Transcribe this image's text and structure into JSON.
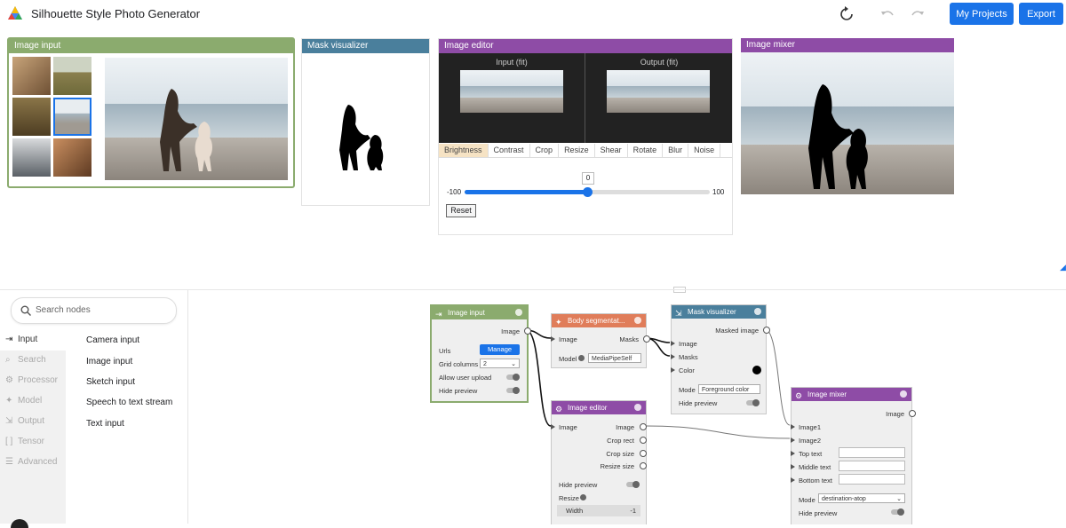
{
  "header": {
    "title": "Silhouette Style Photo Generator",
    "my_projects_label": "My Projects",
    "export_label": "Export"
  },
  "panels": {
    "image_input": {
      "title": "Image input"
    },
    "mask_visualizer": {
      "title": "Mask visualizer"
    },
    "image_editor": {
      "title": "Image editor",
      "input_label": "Input (fit)",
      "output_label": "Output (fit)",
      "tabs": [
        "Brightness",
        "Contrast",
        "Crop",
        "Resize",
        "Shear",
        "Rotate",
        "Blur",
        "Noise"
      ],
      "slider_value": "0",
      "slider_min": "-100",
      "slider_max": "100",
      "slider_fraction": 0.5,
      "reset_label": "Reset"
    },
    "image_mixer": {
      "title": "Image mixer"
    }
  },
  "sidebar": {
    "search_placeholder": "Search nodes",
    "categories": [
      "Input",
      "Search",
      "Processor",
      "Model",
      "Output",
      "Tensor",
      "Advanced"
    ],
    "items": [
      "Camera input",
      "Image input",
      "Sketch input",
      "Speech to text stream",
      "Text input"
    ]
  },
  "nodes": {
    "image_input": {
      "title": "Image input",
      "out_image": "Image",
      "urls": "Urls",
      "manage": "Manage",
      "grid_columns": "Grid columns",
      "grid_value": "2",
      "allow_upload": "Allow user upload",
      "hide_preview": "Hide preview"
    },
    "body_seg": {
      "title": "Body segmentat...",
      "in_image": "Image",
      "out_masks": "Masks",
      "model": "Model",
      "model_value": "MediaPipeSelf"
    },
    "mask_vis": {
      "title": "Mask visualizer",
      "out_masked": "Masked image",
      "in_image": "Image",
      "in_masks": "Masks",
      "in_color": "Color",
      "mode": "Mode",
      "mode_value": "Foreground color",
      "hide_preview": "Hide preview"
    },
    "image_editor": {
      "title": "Image editor",
      "in_image": "Image",
      "out_image": "Image",
      "out_crop_rect": "Crop rect",
      "out_crop_size": "Crop size",
      "out_resize_size": "Resize size",
      "hide_preview": "Hide preview",
      "resize": "Resize",
      "width": "Width",
      "width_value": "-1"
    },
    "image_mixer": {
      "title": "Image mixer",
      "out_image": "Image",
      "in_image1": "Image1",
      "in_image2": "Image2",
      "top_text": "Top text",
      "middle_text": "Middle text",
      "bottom_text": "Bottom text",
      "mode": "Mode",
      "mode_value": "destination-atop",
      "hide_preview": "Hide preview"
    }
  },
  "colors": {
    "accent": "#1a73e8",
    "input_green": "#8bab6e",
    "visualizer_blue": "#4a7f9c",
    "editor_purple": "#8e4ca6",
    "model_orange": "#e07d5a"
  }
}
